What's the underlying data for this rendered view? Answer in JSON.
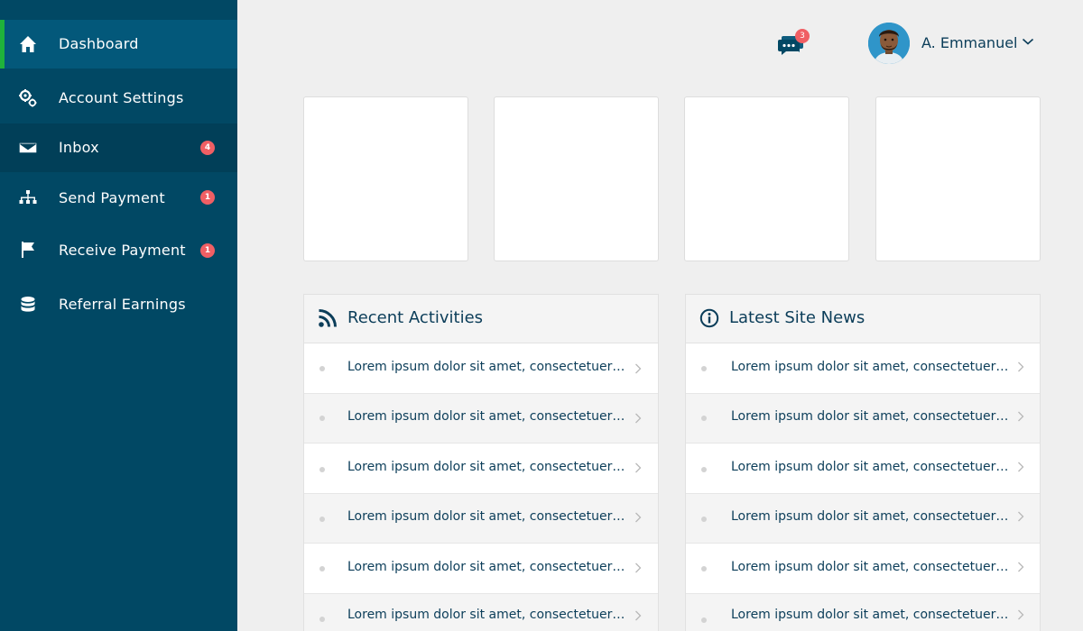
{
  "sidebar": {
    "items": [
      {
        "label": "Dashboard",
        "icon": "home-icon",
        "active": true
      },
      {
        "label": "Account Settings",
        "icon": "gears-icon"
      },
      {
        "label": "Inbox",
        "icon": "envelope-icon",
        "badge": "4"
      },
      {
        "label": "Send Payment",
        "icon": "sitemap-icon",
        "badge": "1"
      },
      {
        "label": "Receive Payment",
        "icon": "flag-icon",
        "badge": "1"
      },
      {
        "label": "Referral Earnings",
        "icon": "database-icon"
      }
    ]
  },
  "header": {
    "messages_badge": "3",
    "user_name": "A. Emmanuel"
  },
  "panels": {
    "activities": {
      "title": "Recent Activities",
      "icon": "rss-icon",
      "items": [
        "Lorem ipsum dolor sit amet, consectetuer adipiscing elit",
        "Lorem ipsum dolor sit amet, consectetuer adipiscing elit",
        "Lorem ipsum dolor sit amet, consectetuer adipiscing elit",
        "Lorem ipsum dolor sit amet, consectetuer adipiscing elit",
        "Lorem ipsum dolor sit amet, consectetuer adipiscing elit",
        "Lorem ipsum dolor sit amet, consectetuer adipiscing elit"
      ]
    },
    "news": {
      "title": "Latest Site News",
      "icon": "info-circle-icon",
      "items": [
        "Lorem ipsum dolor sit amet, consectetuer adipiscing elit",
        "Lorem ipsum dolor sit amet, consectetuer adipiscing elit",
        "Lorem ipsum dolor sit amet, consectetuer adipiscing elit",
        "Lorem ipsum dolor sit amet, consectetuer adipiscing elit",
        "Lorem ipsum dolor sit amet, consectetuer adipiscing elit",
        "Lorem ipsum dolor sit amet, consectetuer adipiscing elit"
      ]
    }
  },
  "colors": {
    "sidebar_bg": "#014864",
    "active_accent": "#1fb23b",
    "badge": "#f05f64",
    "text_primary": "#0b3d59"
  }
}
